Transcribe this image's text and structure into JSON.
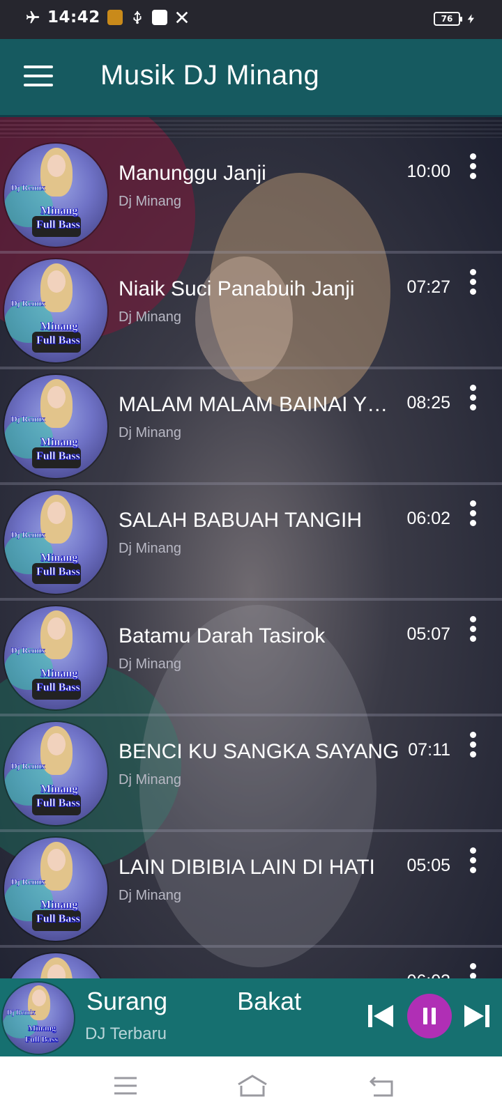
{
  "status_bar": {
    "time": "14:42",
    "battery": "76",
    "icons": [
      "airplane-icon",
      "app-notification-icon",
      "usb-icon",
      "vpn-icon",
      "tools-icon",
      "charging-icon"
    ]
  },
  "app_bar": {
    "title": "Musik DJ Minang",
    "menu_icon": "hamburger-menu-icon"
  },
  "thumbnail": {
    "remix_text": "Dj Remix",
    "minang_text": "Minang",
    "bass_text": "Full Bass"
  },
  "songs": [
    {
      "title": "Manunggu Janji",
      "artist": "Dj Minang",
      "duration": "10:00"
    },
    {
      "title": " Niaik Suci Panabuih Janji",
      "artist": "Dj Minang",
      "duration": "07:27"
    },
    {
      "title": "MALAM MALAM BAINAI YO BADAN BAINAI",
      "artist": "Dj Minang",
      "duration": "08:25"
    },
    {
      "title": "SALAH BABUAH TANGIH",
      "artist": "Dj Minang",
      "duration": "06:02"
    },
    {
      "title": "Batamu Darah Tasirok",
      "artist": "Dj Minang",
      "duration": "05:07"
    },
    {
      "title": " BENCI KU SANGKA SAYANG",
      "artist": "Dj Minang",
      "duration": "07:11"
    },
    {
      "title": "LAIN DIBIBIA LAIN DI HATI",
      "artist": "Dj Minang",
      "duration": "05:05"
    },
    {
      "title": "",
      "artist": "",
      "duration": "06:03"
    }
  ],
  "mini_player": {
    "title": "Surang          Bakat",
    "artist": "DJ Terbaru",
    "state": "playing"
  },
  "colors": {
    "app_bar": "#165a60",
    "mini_player": "#167070",
    "pause_button": "#b02fb5"
  }
}
